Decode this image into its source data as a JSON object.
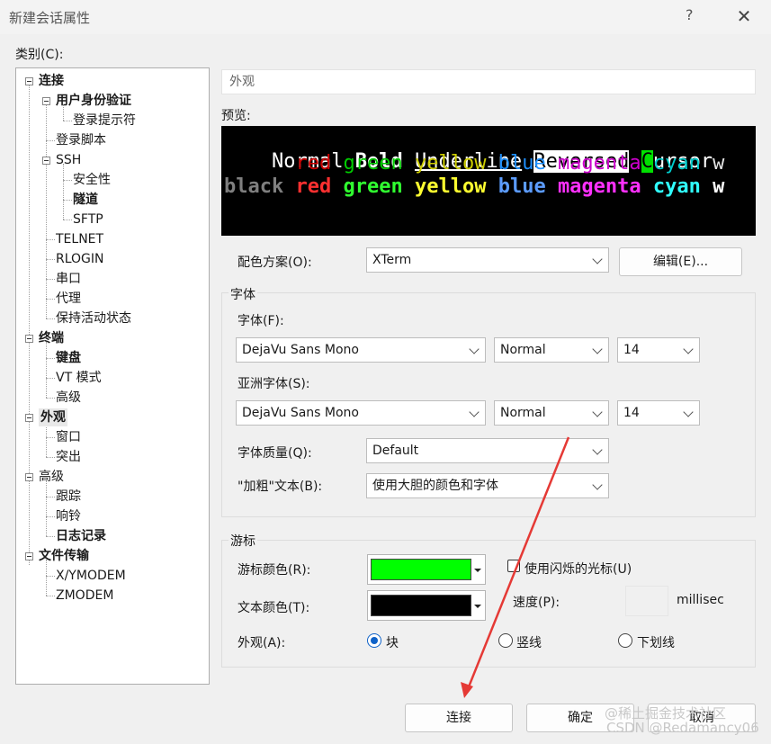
{
  "window": {
    "title": "新建会话属性",
    "help": "?",
    "close": "✕"
  },
  "category_label": "类别(C):",
  "tree": [
    {
      "label": "连接",
      "bold": true
    },
    {
      "label": "用户身份验证",
      "bold": true
    },
    {
      "label": "登录提示符",
      "bold": false
    },
    {
      "label": "登录脚本",
      "bold": false
    },
    {
      "label": "SSH",
      "bold": false
    },
    {
      "label": "安全性",
      "bold": false
    },
    {
      "label": "隧道",
      "bold": true
    },
    {
      "label": "SFTP",
      "bold": false
    },
    {
      "label": "TELNET",
      "bold": false
    },
    {
      "label": "RLOGIN",
      "bold": false
    },
    {
      "label": "串口",
      "bold": false
    },
    {
      "label": "代理",
      "bold": false
    },
    {
      "label": "保持活动状态",
      "bold": false
    },
    {
      "label": "终端",
      "bold": true
    },
    {
      "label": "键盘",
      "bold": true
    },
    {
      "label": "VT 模式",
      "bold": false
    },
    {
      "label": "高级",
      "bold": false
    },
    {
      "label": "外观",
      "bold": true
    },
    {
      "label": "窗口",
      "bold": false
    },
    {
      "label": "突出",
      "bold": false
    },
    {
      "label": "高级",
      "bold": false
    },
    {
      "label": "跟踪",
      "bold": false
    },
    {
      "label": "响铃",
      "bold": false
    },
    {
      "label": "日志记录",
      "bold": true
    },
    {
      "label": "文件传输",
      "bold": true
    },
    {
      "label": "X/YMODEM",
      "bold": false
    },
    {
      "label": "ZMODEM",
      "bold": false
    }
  ],
  "section_title": "外观",
  "preview": {
    "label": "预览:",
    "line1": {
      "normal": "Normal",
      "bold": "Bold",
      "underline": "Underline",
      "reversed": "Reversed",
      "cursor_char": "C",
      "cursor_rest": "ursor"
    },
    "colors": {
      "black": "#000000",
      "red": "#cd0000",
      "green": "#00cd00",
      "yellow": "#cdcd00",
      "blue": "#1e90ff",
      "magenta": "#cd00cd",
      "cyan": "#00cdcd",
      "white": "#e5e5e5",
      "bright_black": "#7f7f7f",
      "bright_red": "#ff3030",
      "bright_green": "#30ff30",
      "bright_yellow": "#ffff30",
      "bright_blue": "#5c9cff",
      "bright_magenta": "#ff30ff",
      "bright_cyan": "#30ffff",
      "bright_white": "#ffffff"
    },
    "words": {
      "black": "black",
      "red": "red",
      "green": "green",
      "yellow": "yellow",
      "blue": "blue",
      "magenta": "magenta",
      "cyan": "cyan",
      "white": "w"
    }
  },
  "color_scheme": {
    "label": "配色方案(O):",
    "value": "XTerm",
    "edit_button": "编辑(E)..."
  },
  "font_group": {
    "legend": "字体",
    "font_label": "字体(F):",
    "font_value": "DejaVu Sans Mono",
    "font_style": "Normal",
    "font_size": "14",
    "asian_label": "亚洲字体(S):",
    "asian_value": "DejaVu Sans Mono",
    "asian_style": "Normal",
    "asian_size": "14",
    "quality_label": "字体质量(Q):",
    "quality_value": "Default",
    "bold_label": "\"加粗\"文本(B):",
    "bold_value": "使用大胆的颜色和字体"
  },
  "cursor_group": {
    "legend": "游标",
    "cursor_color_label": "游标颜色(R):",
    "cursor_color": "#00ff00",
    "text_color_label": "文本颜色(T):",
    "text_color": "#000000",
    "blink_label": "使用闪烁的光标(U)",
    "blink_checked": false,
    "speed_label": "速度(P):",
    "speed_unit": "millisec",
    "shape_label": "外观(A):",
    "shapes": [
      "块",
      "竖线",
      "下划线"
    ],
    "selected_shape": "块"
  },
  "buttons": {
    "connect": "连接",
    "ok": "确定",
    "cancel": "取消"
  },
  "watermark": {
    "line1": "@稀土掘金技术社区",
    "line2": "CSDN @Redamancy06"
  },
  "accent": "#0f62c8"
}
